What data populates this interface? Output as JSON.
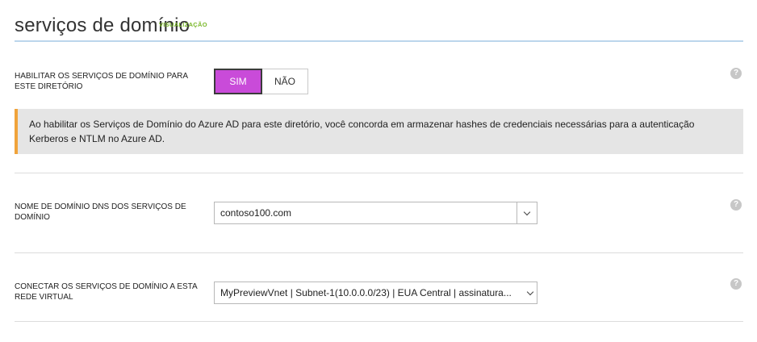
{
  "header": {
    "title": "serviços de domínio",
    "badge": "VISUALIZAÇÃO"
  },
  "enable_services": {
    "label": "HABILITAR OS SERVIÇOS DE DOMÍNIO PARA ESTE DIRETÓRIO",
    "options": [
      "SIM",
      "NÃO"
    ],
    "selected": "SIM",
    "help_icon": "question-circle-icon"
  },
  "notice": {
    "text": "Ao habilitar os Serviços de Domínio do Azure AD para este diretório, você concorda em armazenar hashes de credenciais necessárias para a autenticação Kerberos e NTLM no Azure AD."
  },
  "dns_name": {
    "label": "NOME DE DOMÍNIO DNS DOS SERVIÇOS DE DOMÍNIO",
    "value": "contoso100.com",
    "help_icon": "question-circle-icon"
  },
  "vnet": {
    "label": "CONECTAR OS SERVIÇOS DE DOMÍNIO A ESTA REDE VIRTUAL",
    "value": "MyPreviewVnet | Subnet-1(10.0.0.0/23) | EUA Central | assinatura...",
    "help_icon": "question-circle-icon"
  },
  "colors": {
    "accent_toggle": "#c94bd9",
    "notice_border": "#f0a33b",
    "badge": "#7ab829",
    "header_rule": "#bcd6ec"
  }
}
